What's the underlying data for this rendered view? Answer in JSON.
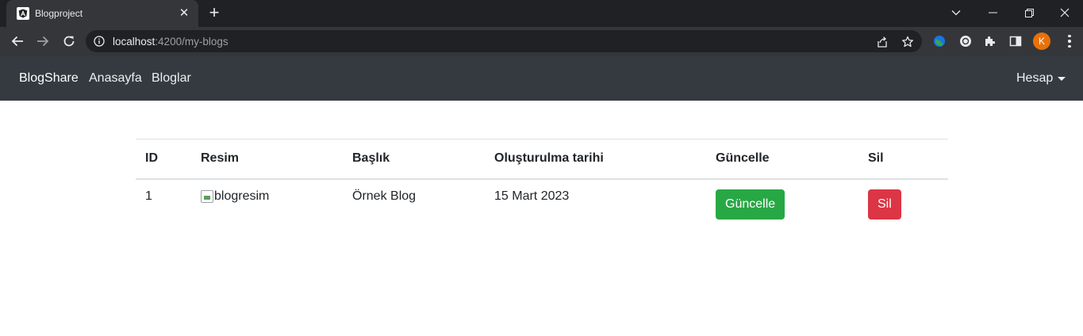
{
  "browser": {
    "tab_title": "Blogproject",
    "tab_close": "✕",
    "new_tab": "+",
    "url_host": "localhost",
    "url_path": ":4200/my-blogs",
    "profile_initial": "K"
  },
  "navbar": {
    "brand": "BlogShare",
    "links": [
      "Anasayfa",
      "Bloglar"
    ],
    "account": "Hesap"
  },
  "table": {
    "headers": [
      "ID",
      "Resim",
      "Başlık",
      "Oluşturulma tarihi",
      "Güncelle",
      "Sil"
    ],
    "rows": [
      {
        "id": "1",
        "image_alt": "blogresim",
        "title": "Örnek Blog",
        "created": "15 Mart 2023",
        "update_label": "Güncelle",
        "delete_label": "Sil"
      }
    ]
  },
  "colors": {
    "navbar_bg": "#343a40",
    "update_button": "#28a745",
    "delete_button": "#dc3545",
    "avatar": "#e8710a"
  },
  "icons": [
    "angular-logo-icon",
    "close-icon",
    "plus-icon",
    "chevron-down-icon",
    "minimize-icon",
    "maximize-icon",
    "close-window-icon",
    "back-arrow-icon",
    "forward-arrow-icon",
    "reload-icon",
    "info-icon",
    "share-icon",
    "star-icon",
    "extension-globe-icon",
    "extension-circle-icon",
    "puzzle-icon",
    "side-panel-icon",
    "more-menu-icon"
  ]
}
